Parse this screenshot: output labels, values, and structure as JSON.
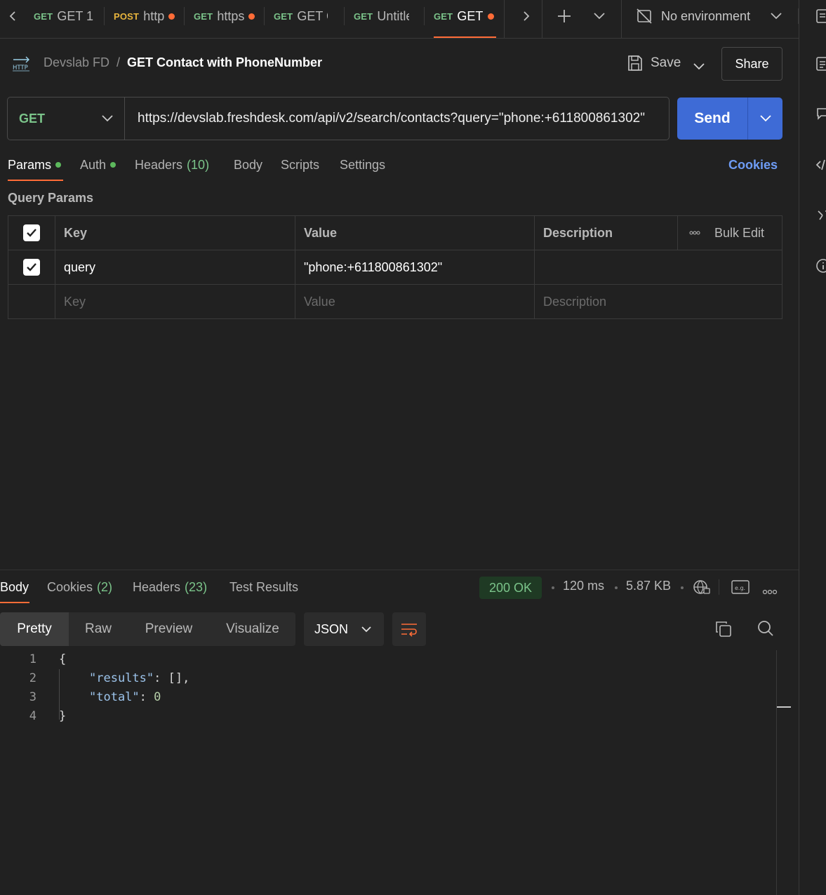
{
  "tabs": [
    {
      "method": "GET",
      "title": "GET 1",
      "unsaved": false
    },
    {
      "method": "POST",
      "title": "http",
      "unsaved": true
    },
    {
      "method": "GET",
      "title": "https",
      "unsaved": true
    },
    {
      "method": "GET",
      "title": "GET C",
      "unsaved": false
    },
    {
      "method": "GET",
      "title": "Untitle",
      "unsaved": false
    },
    {
      "method": "GET",
      "title": "GET C",
      "unsaved": true,
      "active": true
    }
  ],
  "environment": {
    "label": "No environment"
  },
  "breadcrumb": {
    "badge": "HTTP",
    "collection": "Devslab FD",
    "separator": "/",
    "request": "GET Contact with PhoneNumber"
  },
  "actions": {
    "save": "Save",
    "share": "Share"
  },
  "request": {
    "method": "GET",
    "url": "https://devslab.freshdesk.com/api/v2/search/contacts?query=\"phone:+611800861302\"",
    "send": "Send"
  },
  "request_tabs": {
    "params": "Params",
    "auth": "Auth",
    "headers": "Headers",
    "headers_count": "(10)",
    "body": "Body",
    "scripts": "Scripts",
    "settings": "Settings",
    "cookies": "Cookies"
  },
  "query_params": {
    "title": "Query Params",
    "columns": {
      "key": "Key",
      "value": "Value",
      "description": "Description",
      "bulk_edit": "Bulk Edit"
    },
    "rows": [
      {
        "key": "query",
        "value": "\"phone:+611800861302\"",
        "checked": true
      }
    ],
    "placeholders": {
      "key": "Key",
      "value": "Value",
      "description": "Description"
    }
  },
  "response": {
    "tabs": {
      "body": "Body",
      "cookies": "Cookies",
      "cookies_count": "(2)",
      "headers": "Headers",
      "headers_count": "(23)",
      "tests": "Test Results"
    },
    "status": "200 OK",
    "time": "120 ms",
    "size": "5.87 KB",
    "view_modes": [
      "Pretty",
      "Raw",
      "Preview",
      "Visualize"
    ],
    "format": "JSON",
    "line_numbers": [
      "1",
      "2",
      "3",
      "4"
    ],
    "body": {
      "open": "{",
      "key1": "\"results\"",
      "val1": "[],",
      "key2": "\"total\"",
      "val2": "0",
      "close": "}"
    }
  }
}
